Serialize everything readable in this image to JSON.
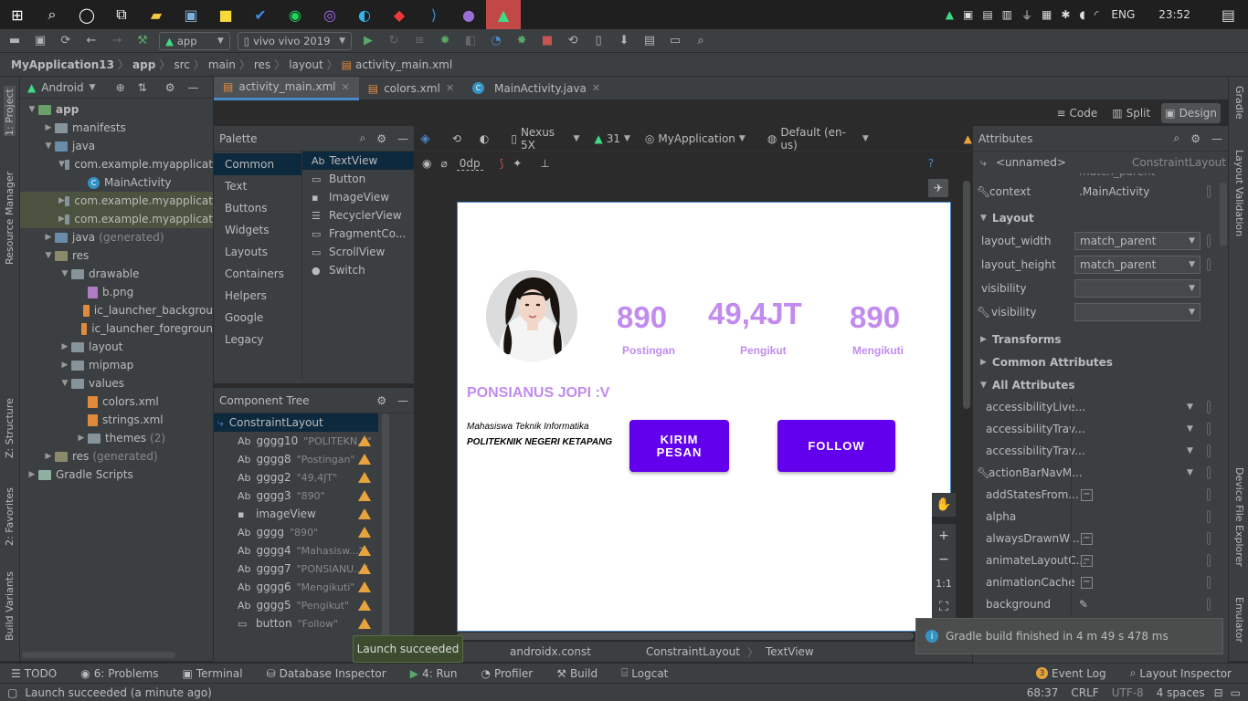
{
  "taskbar": {
    "lang": "ENG",
    "time": "23:52"
  },
  "toolbar": {
    "module": "app",
    "device": "vivo vivo 2019"
  },
  "breadcrumb": [
    "MyApplication13",
    "app",
    "src",
    "main",
    "res",
    "layout",
    "activity_main.xml"
  ],
  "project": {
    "view_label": "Android",
    "items": [
      {
        "label": "app",
        "level": 0,
        "type": "module"
      },
      {
        "label": "manifests",
        "level": 1,
        "type": "folder"
      },
      {
        "label": "java",
        "level": 1,
        "type": "folder"
      },
      {
        "label": "com.example.myapplicat",
        "level": 2,
        "type": "pkg"
      },
      {
        "label": "MainActivity",
        "level": 3,
        "type": "class"
      },
      {
        "label": "com.example.myapplicat",
        "level": 2,
        "type": "pkg",
        "sel": true
      },
      {
        "label": "com.example.myapplicat",
        "level": 2,
        "type": "pkg",
        "sel": true
      },
      {
        "label": "java",
        "suffix": "(generated)",
        "level": 1,
        "type": "folder"
      },
      {
        "label": "res",
        "level": 1,
        "type": "folder"
      },
      {
        "label": "drawable",
        "level": 2,
        "type": "folder"
      },
      {
        "label": "b.png",
        "level": 3,
        "type": "png"
      },
      {
        "label": "ic_launcher_backgrou",
        "level": 3,
        "type": "xml"
      },
      {
        "label": "ic_launcher_foregroun",
        "level": 3,
        "type": "xml"
      },
      {
        "label": "layout",
        "level": 2,
        "type": "folder"
      },
      {
        "label": "mipmap",
        "level": 2,
        "type": "folder"
      },
      {
        "label": "values",
        "level": 2,
        "type": "folder"
      },
      {
        "label": "colors.xml",
        "level": 3,
        "type": "xml"
      },
      {
        "label": "strings.xml",
        "level": 3,
        "type": "xml"
      },
      {
        "label": "themes",
        "suffix": "(2)",
        "level": 3,
        "type": "folder"
      },
      {
        "label": "res",
        "suffix": "(generated)",
        "level": 1,
        "type": "folder"
      },
      {
        "label": "Gradle Scripts",
        "level": 0,
        "type": "gradle"
      }
    ]
  },
  "left_tabs": [
    "1: Project",
    "Resource Manager",
    "Z: Structure",
    "2: Favorites",
    "Build Variants"
  ],
  "right_tabs": [
    "Gradle",
    "Layout Validation",
    "Device File Explorer",
    "Emulator"
  ],
  "editor_tabs": [
    {
      "label": "activity_main.xml",
      "active": true
    },
    {
      "label": "colors.xml",
      "active": false
    },
    {
      "label": "MainActivity.java",
      "active": false
    }
  ],
  "view_modes": {
    "code": "Code",
    "split": "Split",
    "design": "Design"
  },
  "palette": {
    "title": "Palette",
    "categories": [
      "Common",
      "Text",
      "Buttons",
      "Widgets",
      "Layouts",
      "Containers",
      "Helpers",
      "Google",
      "Legacy"
    ],
    "items": [
      {
        "icon": "Ab",
        "label": "TextView"
      },
      {
        "icon": "▭",
        "label": "Button"
      },
      {
        "icon": "▪",
        "label": "ImageView"
      },
      {
        "icon": "☰",
        "label": "RecyclerView"
      },
      {
        "icon": "▭",
        "label": "FragmentCo..."
      },
      {
        "icon": "▭",
        "label": "ScrollView"
      },
      {
        "icon": "●",
        "label": "Switch"
      }
    ]
  },
  "component_tree": {
    "title": "Component Tree",
    "root": "ConstraintLayout",
    "items": [
      {
        "icon": "Ab",
        "name": "gggg10",
        "text": "\"POLITEKN...\""
      },
      {
        "icon": "Ab",
        "name": "gggg8",
        "text": "\"Postingan\""
      },
      {
        "icon": "Ab",
        "name": "gggg2",
        "text": "\"49,4JT\""
      },
      {
        "icon": "Ab",
        "name": "gggg3",
        "text": "\"890\""
      },
      {
        "icon": "img",
        "name": "imageView",
        "text": ""
      },
      {
        "icon": "Ab",
        "name": "gggg",
        "text": "\"890\""
      },
      {
        "icon": "Ab",
        "name": "gggg4",
        "text": "\"Mahasisw...\""
      },
      {
        "icon": "Ab",
        "name": "gggg7",
        "text": "\"PONSIANU...\""
      },
      {
        "icon": "Ab",
        "name": "gggg6",
        "text": "\"Mengikuti\""
      },
      {
        "icon": "Ab",
        "name": "gggg5",
        "text": "\"Pengikut\""
      },
      {
        "icon": "btn",
        "name": "button",
        "text": "\"Follow\""
      }
    ]
  },
  "design_toolbar": {
    "device": "Nexus 5X",
    "api": "31",
    "theme": "MyApplication",
    "locale": "Default (en-us)",
    "margin": "0dp"
  },
  "preview": {
    "stats": [
      {
        "value": "890",
        "label": "Postingan"
      },
      {
        "value": "49,4JT",
        "label": "Pengikut"
      },
      {
        "value": "890",
        "label": "Mengikuti"
      }
    ],
    "name": "PONSIANUS JOPI :V",
    "bio1": "Mahasiswa Teknik Informatika",
    "bio2": "POLITEKNIK NEGERI KETAPANG",
    "btn_message": "KIRIM\nPESAN",
    "btn_follow": "FOLLOW",
    "primary_color": "#6200ee",
    "text_color": "#c28bf0"
  },
  "zoom": {
    "ratio": "1:1"
  },
  "design_breadcrumb": [
    "androidx.const",
    "ConstraintLayout",
    "TextView"
  ],
  "attributes": {
    "title": "Attributes",
    "component": "<unnamed>",
    "component_type": "ConstraintLayout",
    "cut_value": "match_parent",
    "context_label": "context",
    "context_value": ".MainActivity",
    "sections": {
      "layout": "Layout",
      "transforms": "Transforms",
      "common": "Common Attributes",
      "all": "All Attributes"
    },
    "layout_rows": [
      {
        "name": "layout_width",
        "value": "match_parent"
      },
      {
        "name": "layout_height",
        "value": "match_parent"
      },
      {
        "name": "visibility",
        "value": ""
      },
      {
        "name": "visibility",
        "value": "",
        "wrench": true
      }
    ],
    "all_rows": [
      {
        "name": "accessibilityLive...",
        "kind": "dd"
      },
      {
        "name": "accessibilityTrav...",
        "kind": "dd"
      },
      {
        "name": "accessibilityTrav...",
        "kind": "dd"
      },
      {
        "name": "actionBarNavM...",
        "kind": "dd",
        "wrench": true
      },
      {
        "name": "addStatesFrom...",
        "kind": "minus"
      },
      {
        "name": "alpha",
        "kind": "none"
      },
      {
        "name": "alwaysDrawnWi...",
        "kind": "minus"
      },
      {
        "name": "animateLayoutC...",
        "kind": "minus"
      },
      {
        "name": "animationCache",
        "kind": "minus"
      },
      {
        "name": "background",
        "kind": "picker"
      }
    ]
  },
  "notification": "Gradle build finished in 4 m 49 s 478 ms",
  "tooltip": "Launch succeeded",
  "bottom_tabs": [
    "TODO",
    "6: Problems",
    "Terminal",
    "Database Inspector",
    "4: Run",
    "Profiler",
    "Build",
    "Logcat"
  ],
  "bottom_right_tabs": {
    "event_log": "Event Log",
    "event_count": "3",
    "layout_inspector": "Layout Inspector"
  },
  "status": {
    "message": "Launch succeeded (a minute ago)",
    "position": "68:37",
    "line_sep": "CRLF",
    "encoding": "UTF-8",
    "indent": "4 spaces"
  }
}
